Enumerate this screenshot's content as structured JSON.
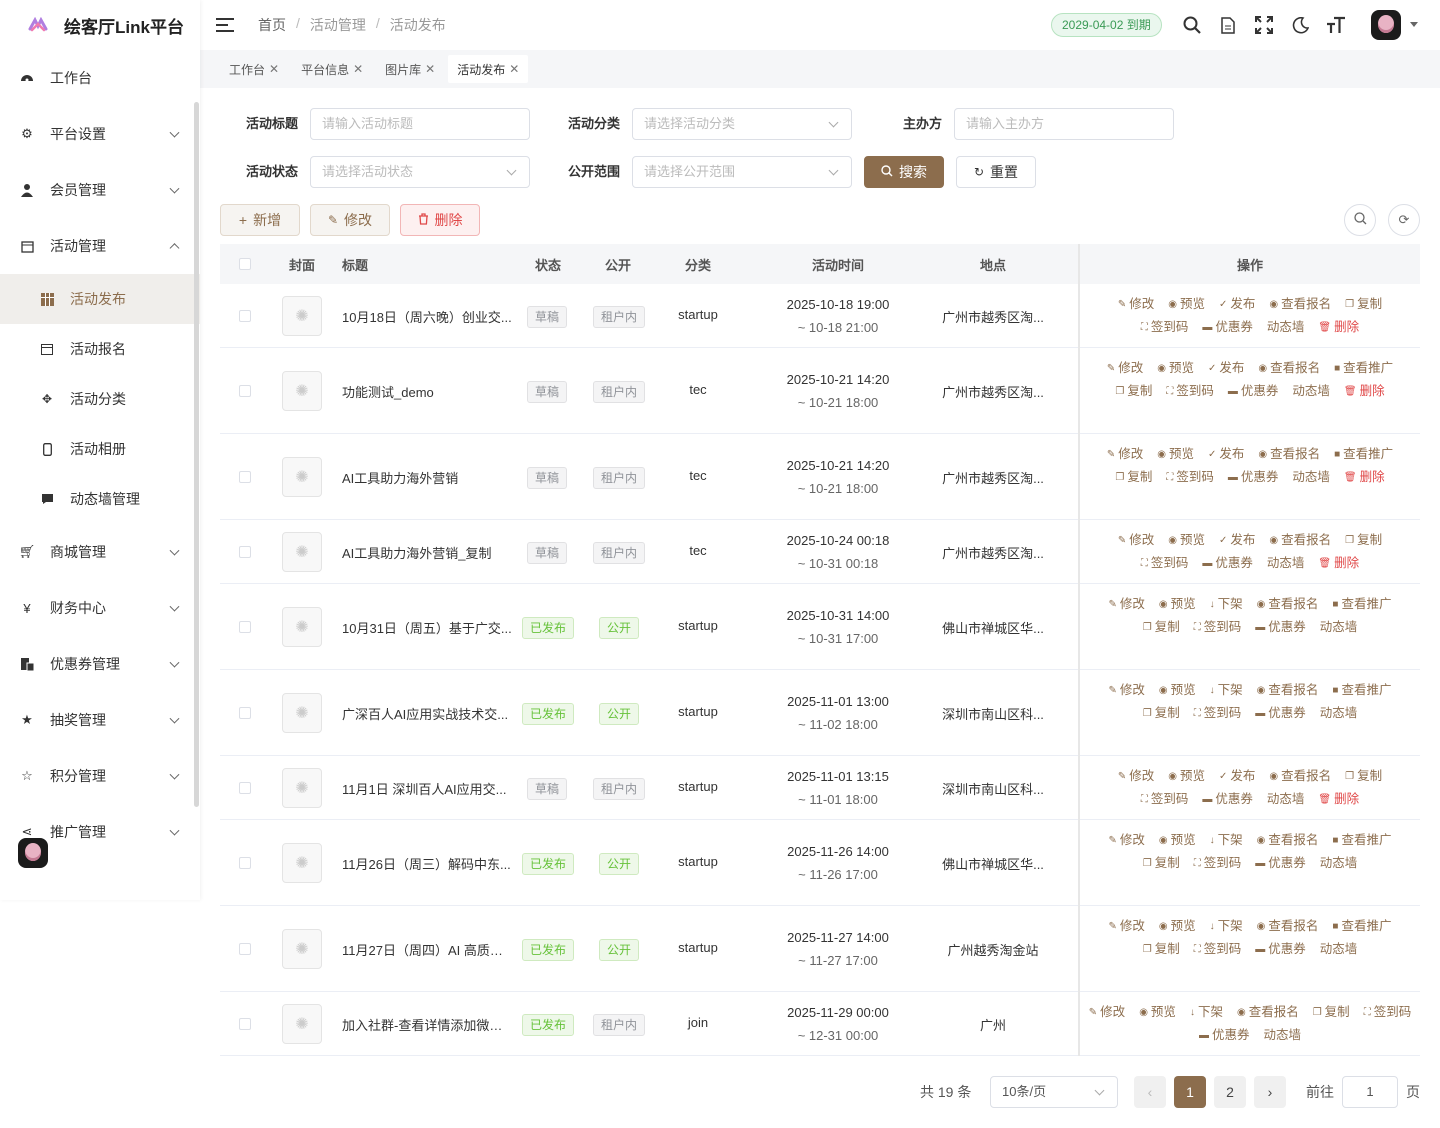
{
  "app": {
    "title": "绘客厅Link平台"
  },
  "sidebar": {
    "items": [
      {
        "label": "工作台",
        "icon": "dashboard-icon"
      },
      {
        "label": "平台设置",
        "icon": "gear-icon"
      },
      {
        "label": "会员管理",
        "icon": "user-icon"
      },
      {
        "label": "活动管理",
        "icon": "calendar-icon",
        "expanded": true
      },
      {
        "label": "商城管理",
        "icon": "cart-icon"
      },
      {
        "label": "财务中心",
        "icon": "yen-icon"
      },
      {
        "label": "优惠券管理",
        "icon": "coupon-icon"
      },
      {
        "label": "抽奖管理",
        "icon": "star-icon"
      },
      {
        "label": "积分管理",
        "icon": "star-outline-icon"
      },
      {
        "label": "推广管理",
        "icon": "share-icon"
      }
    ],
    "sub_items": [
      {
        "label": "活动发布",
        "icon": "grid-icon",
        "active": true
      },
      {
        "label": "活动报名",
        "icon": "calendar-icon"
      },
      {
        "label": "活动分类",
        "icon": "move-icon"
      },
      {
        "label": "活动相册",
        "icon": "phone-icon"
      },
      {
        "label": "动态墙管理",
        "icon": "chat-icon"
      }
    ]
  },
  "header": {
    "breadcrumb": [
      "首页",
      "活动管理",
      "活动发布"
    ],
    "expire_badge": "2029-04-02 到期",
    "icons": [
      "search-icon",
      "document-icon",
      "fullscreen-icon",
      "moon-icon",
      "font-size-icon"
    ]
  },
  "tabs": [
    {
      "label": "工作台"
    },
    {
      "label": "平台信息"
    },
    {
      "label": "图片库"
    },
    {
      "label": "活动发布",
      "active": true
    }
  ],
  "filters": {
    "title_label": "活动标题",
    "title_placeholder": "请输入活动标题",
    "category_label": "活动分类",
    "category_placeholder": "请选择活动分类",
    "host_label": "主办方",
    "host_placeholder": "请输入主办方",
    "status_label": "活动状态",
    "status_placeholder": "请选择活动状态",
    "scope_label": "公开范围",
    "scope_placeholder": "请选择公开范围",
    "search_btn": "搜索",
    "reset_btn": "重置"
  },
  "toolbar": {
    "add": "新增",
    "edit": "修改",
    "delete": "删除"
  },
  "table": {
    "columns": [
      "封面",
      "标题",
      "状态",
      "公开",
      "分类",
      "活动时间",
      "地点",
      "操作"
    ],
    "rows": [
      {
        "title": "10月18日（周六晚）创业交...",
        "status": "草稿",
        "scope": "租户内",
        "category": "startup",
        "time1": "2025-10-18 19:00",
        "time2": "~ 10-18 21:00",
        "location": "广州市越秀区淘...",
        "ops": [
          "修改",
          "预览",
          "发布",
          "查看报名",
          "复制",
          "签到码",
          "优惠券",
          "动态墙",
          "删除"
        ]
      },
      {
        "title": "功能测试_demo",
        "status": "草稿",
        "scope": "租户内",
        "category": "tec",
        "time1": "2025-10-21 14:20",
        "time2": "~ 10-21 18:00",
        "location": "广州市越秀区淘...",
        "ops": [
          "修改",
          "预览",
          "发布",
          "查看报名",
          "查看推广",
          "复制",
          "签到码",
          "优惠券",
          "动态墙",
          "删除"
        ]
      },
      {
        "title": "AI工具助力海外营销",
        "status": "草稿",
        "scope": "租户内",
        "category": "tec",
        "time1": "2025-10-21 14:20",
        "time2": "~ 10-21 18:00",
        "location": "广州市越秀区淘...",
        "ops": [
          "修改",
          "预览",
          "发布",
          "查看报名",
          "查看推广",
          "复制",
          "签到码",
          "优惠券",
          "动态墙",
          "删除"
        ]
      },
      {
        "title": "AI工具助力海外营销_复制",
        "status": "草稿",
        "scope": "租户内",
        "category": "tec",
        "time1": "2025-10-24 00:18",
        "time2": "~ 10-31 00:18",
        "location": "广州市越秀区淘...",
        "ops": [
          "修改",
          "预览",
          "发布",
          "查看报名",
          "复制",
          "签到码",
          "优惠券",
          "动态墙",
          "删除"
        ]
      },
      {
        "title": "10月31日（周五）基于广交...",
        "status": "已发布",
        "scope": "公开",
        "category": "startup",
        "time1": "2025-10-31 14:00",
        "time2": "~ 10-31 17:00",
        "location": "佛山市禅城区华...",
        "ops": [
          "修改",
          "预览",
          "下架",
          "查看报名",
          "查看推广",
          "复制",
          "签到码",
          "优惠券",
          "动态墙"
        ]
      },
      {
        "title": "广深百人AI应用实战技术交...",
        "status": "已发布",
        "scope": "公开",
        "category": "startup",
        "time1": "2025-11-01 13:00",
        "time2": "~ 11-02 18:00",
        "location": "深圳市南山区科...",
        "ops": [
          "修改",
          "预览",
          "下架",
          "查看报名",
          "查看推广",
          "复制",
          "签到码",
          "优惠券",
          "动态墙"
        ]
      },
      {
        "title": "11月1日 深圳百人AI应用交...",
        "status": "草稿",
        "scope": "租户内",
        "category": "startup",
        "time1": "2025-11-01 13:15",
        "time2": "~ 11-01 18:00",
        "location": "深圳市南山区科...",
        "ops": [
          "修改",
          "预览",
          "发布",
          "查看报名",
          "复制",
          "签到码",
          "优惠券",
          "动态墙",
          "删除"
        ]
      },
      {
        "title": "11月26日（周三）解码中东...",
        "status": "已发布",
        "scope": "公开",
        "category": "startup",
        "time1": "2025-11-26 14:00",
        "time2": "~ 11-26 17:00",
        "location": "佛山市禅城区华...",
        "ops": [
          "修改",
          "预览",
          "下架",
          "查看报名",
          "查看推广",
          "复制",
          "签到码",
          "优惠券",
          "动态墙"
        ]
      },
      {
        "title": "11月27日（周四）AI 高质量...",
        "status": "已发布",
        "scope": "公开",
        "category": "startup",
        "time1": "2025-11-27 14:00",
        "time2": "~ 11-27 17:00",
        "location": "广州越秀淘金站",
        "ops": [
          "修改",
          "预览",
          "下架",
          "查看报名",
          "查看推广",
          "复制",
          "签到码",
          "优惠券",
          "动态墙"
        ]
      },
      {
        "title": "加入社群-查看详情添加微信...",
        "status": "已发布",
        "scope": "租户内",
        "category": "join",
        "time1": "2025-11-29 00:00",
        "time2": "~ 12-31 00:00",
        "location": "广州",
        "ops": [
          "修改",
          "预览",
          "下架",
          "查看报名",
          "复制",
          "签到码",
          "优惠券",
          "动态墙"
        ]
      }
    ]
  },
  "pagination": {
    "total": "共 19 条",
    "page_size": "10条/页",
    "pages": [
      "1",
      "2"
    ],
    "current": "1",
    "goto_label": "前往",
    "goto_value": "1",
    "goto_suffix": "页"
  },
  "colors": {
    "primary": "#8c6d4d",
    "danger": "#e04848",
    "success": "#67c23a"
  }
}
